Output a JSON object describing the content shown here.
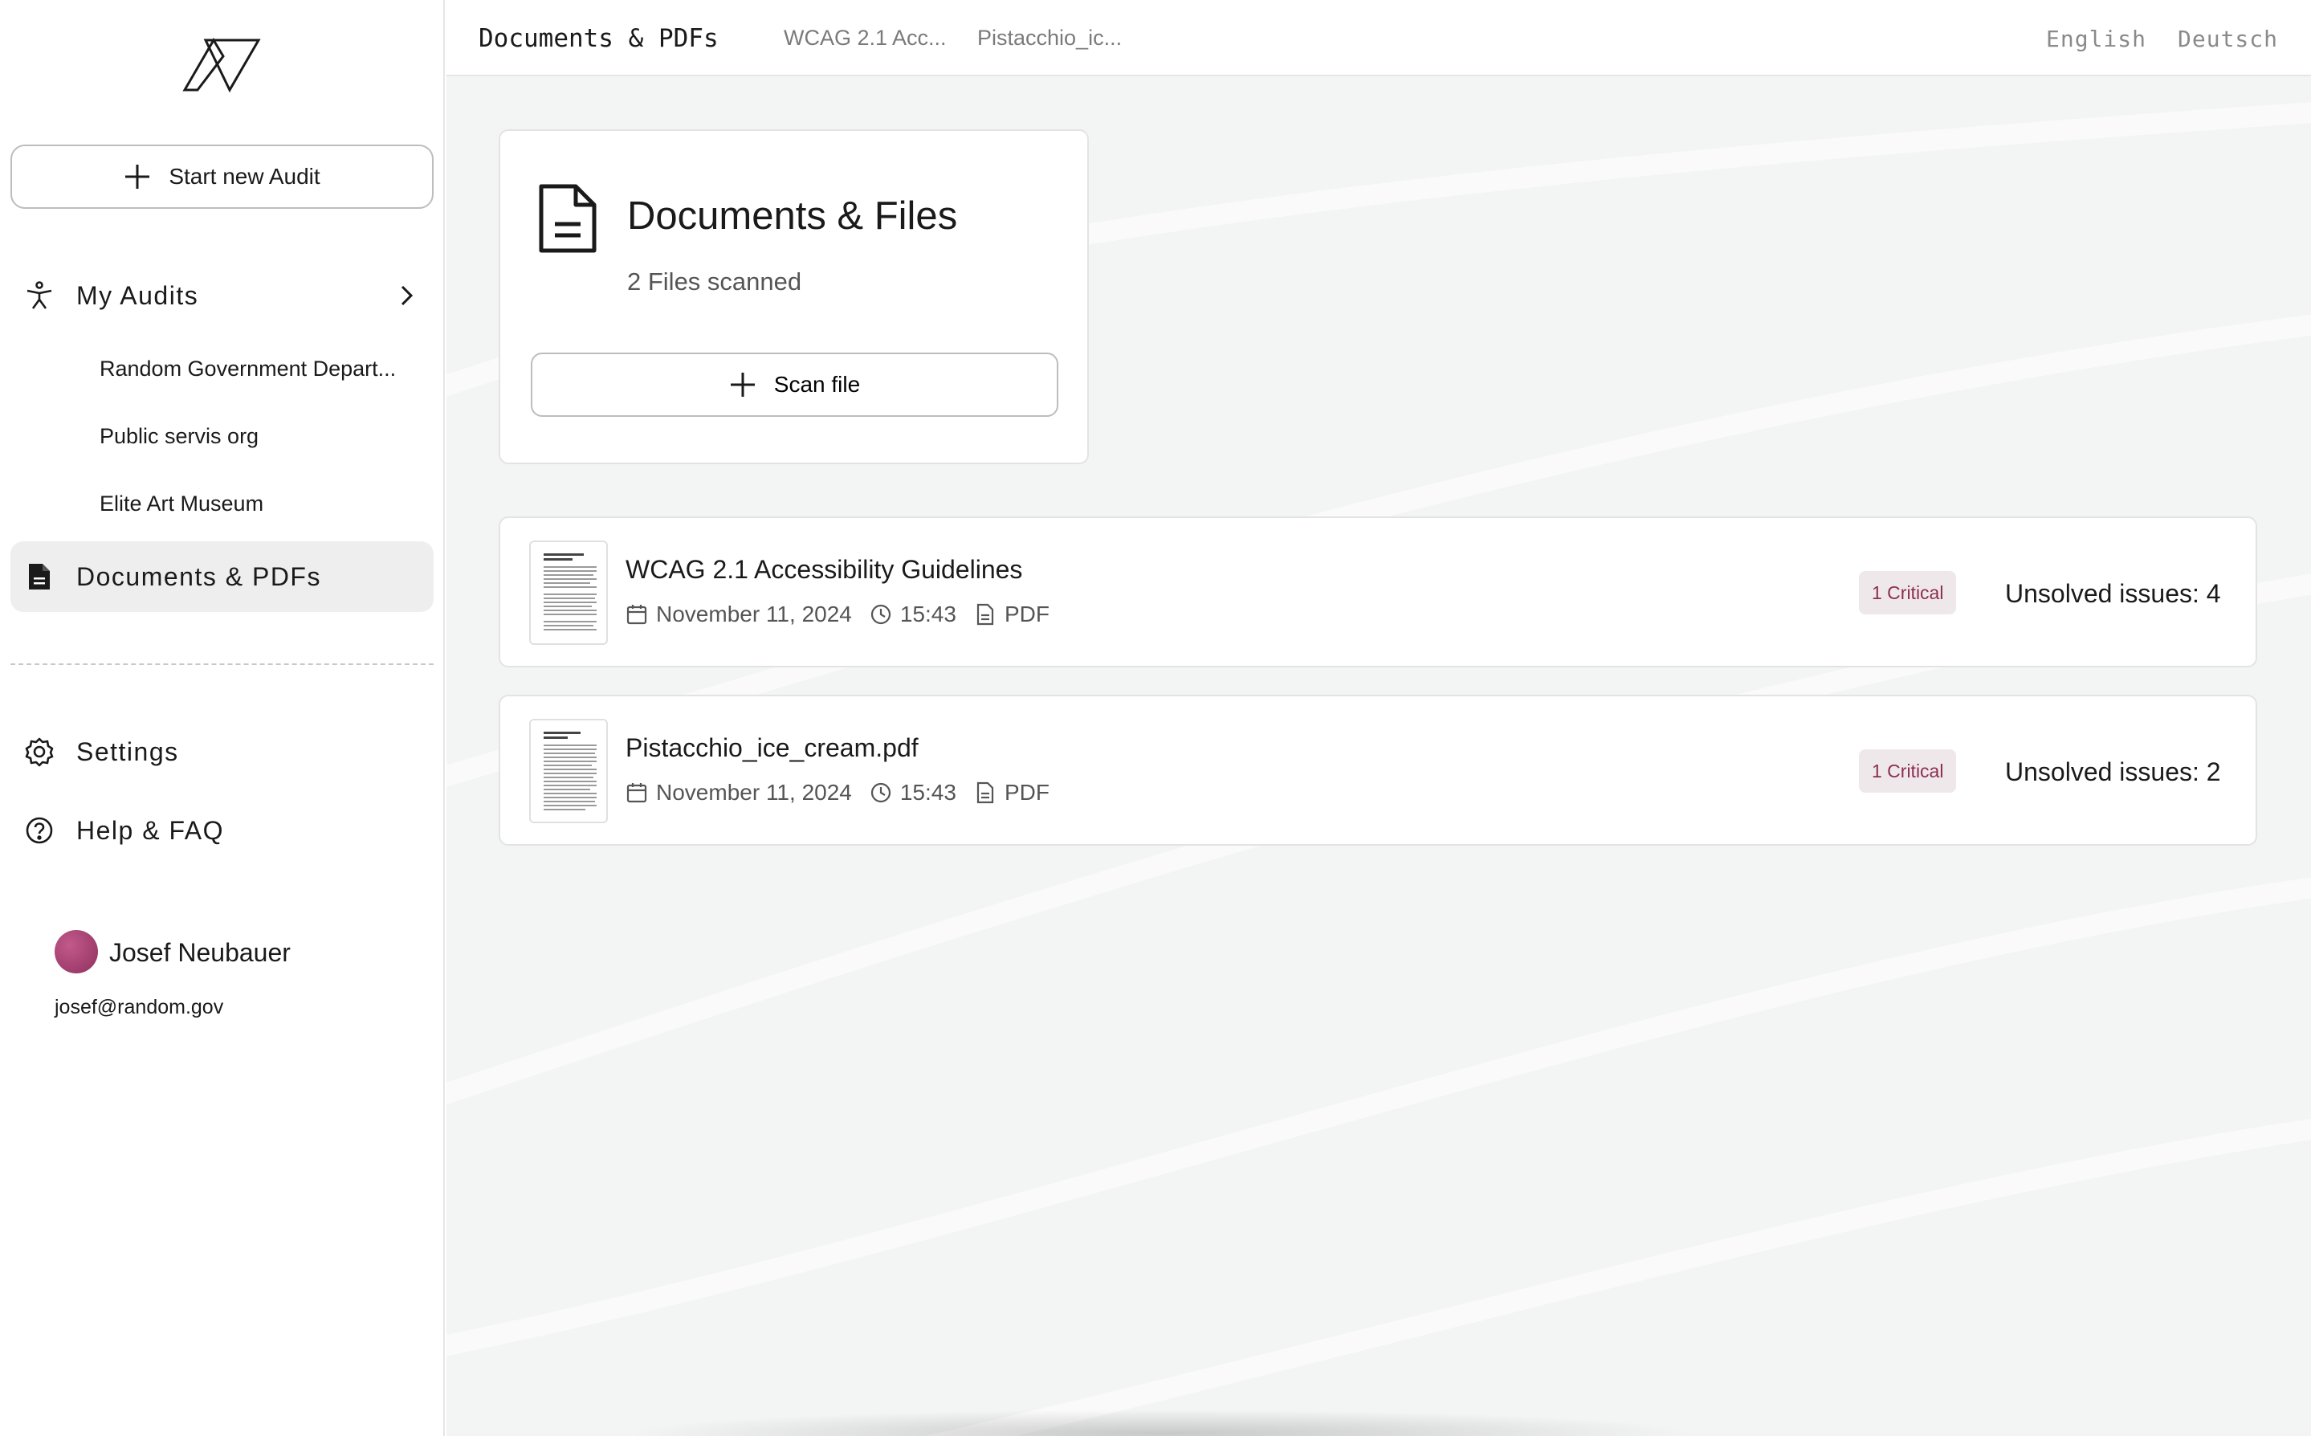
{
  "sidebar": {
    "new_audit_label": "Start new Audit",
    "my_audits_label": "My Audits",
    "audits": [
      "Random Government Depart...",
      "Public servis org",
      "Elite Art Museum"
    ],
    "documents_label": "Documents & PDFs",
    "settings_label": "Settings",
    "help_label": "Help & FAQ",
    "user": {
      "name": "Josef Neubauer",
      "email": "josef@random.gov"
    }
  },
  "topbar": {
    "title": "Documents & PDFs",
    "tabs": [
      "WCAG 2.1 Acc...",
      "Pistacchio_ic..."
    ],
    "languages": [
      "English",
      "Deutsch"
    ]
  },
  "summary": {
    "title": "Documents & Files",
    "subtitle": "2 Files scanned",
    "scan_label": "Scan file"
  },
  "files": [
    {
      "name": "WCAG 2.1 Accessibility Guidelines",
      "date": "November 11, 2024",
      "time": "15:43",
      "type": "PDF",
      "badge": "1 Critical",
      "issues": "Unsolved issues: 4"
    },
    {
      "name": "Pistacchio_ice_cream.pdf",
      "date": "November 11, 2024",
      "time": "15:43",
      "type": "PDF",
      "badge": "1 Critical",
      "issues": "Unsolved issues: 2"
    }
  ],
  "colors": {
    "accent": "#8c2e52",
    "badge_bg": "#efe8ea",
    "active_nav": "#eeeeee",
    "main_bg": "#f3f4f4"
  }
}
